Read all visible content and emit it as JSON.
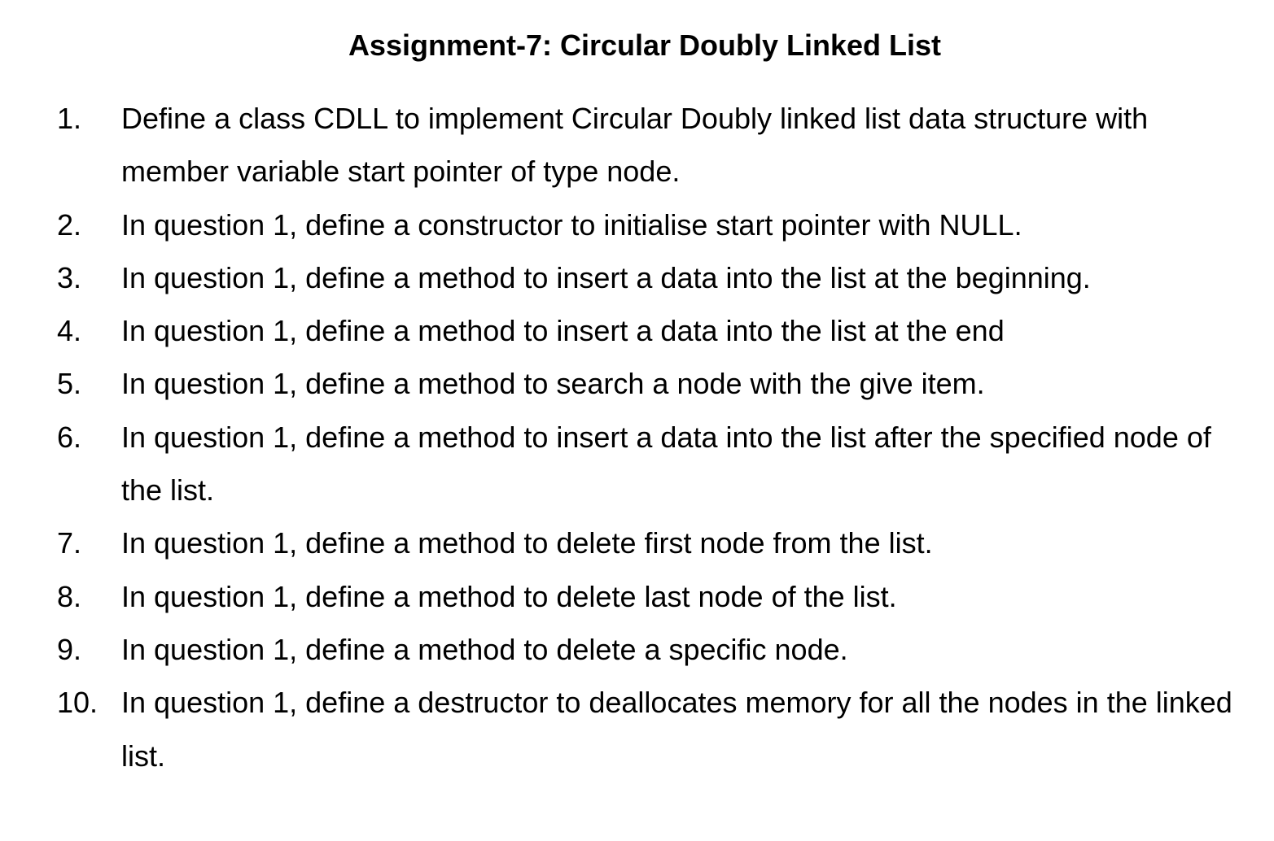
{
  "document": {
    "title": "Assignment-7: Circular Doubly Linked List",
    "questions": [
      {
        "number": "1.",
        "text": "Define a class CDLL to implement Circular Doubly linked list data structure with member variable start pointer of type node."
      },
      {
        "number": "2.",
        "text": "In question 1, define a constructor to initialise start pointer with NULL."
      },
      {
        "number": "3.",
        "text": "In question 1, define a method to insert a data into the list at the beginning."
      },
      {
        "number": "4.",
        "text": "In question 1, define a method to insert a data into the list at the end"
      },
      {
        "number": "5.",
        "text": "In question 1, define a method to search a node with the give item."
      },
      {
        "number": "6.",
        "text": "In question 1, define a method to insert a data into the list after the specified node of the list."
      },
      {
        "number": "7.",
        "text": "In question 1, define a method to delete first node from the list."
      },
      {
        "number": "8.",
        "text": "In question 1, define a method to delete last node of the list."
      },
      {
        "number": "9.",
        "text": "In question 1, define a method to delete a specific node."
      },
      {
        "number": "10.",
        "text": "In question 1, define a destructor to deallocates memory for all the nodes in the linked list."
      }
    ]
  }
}
